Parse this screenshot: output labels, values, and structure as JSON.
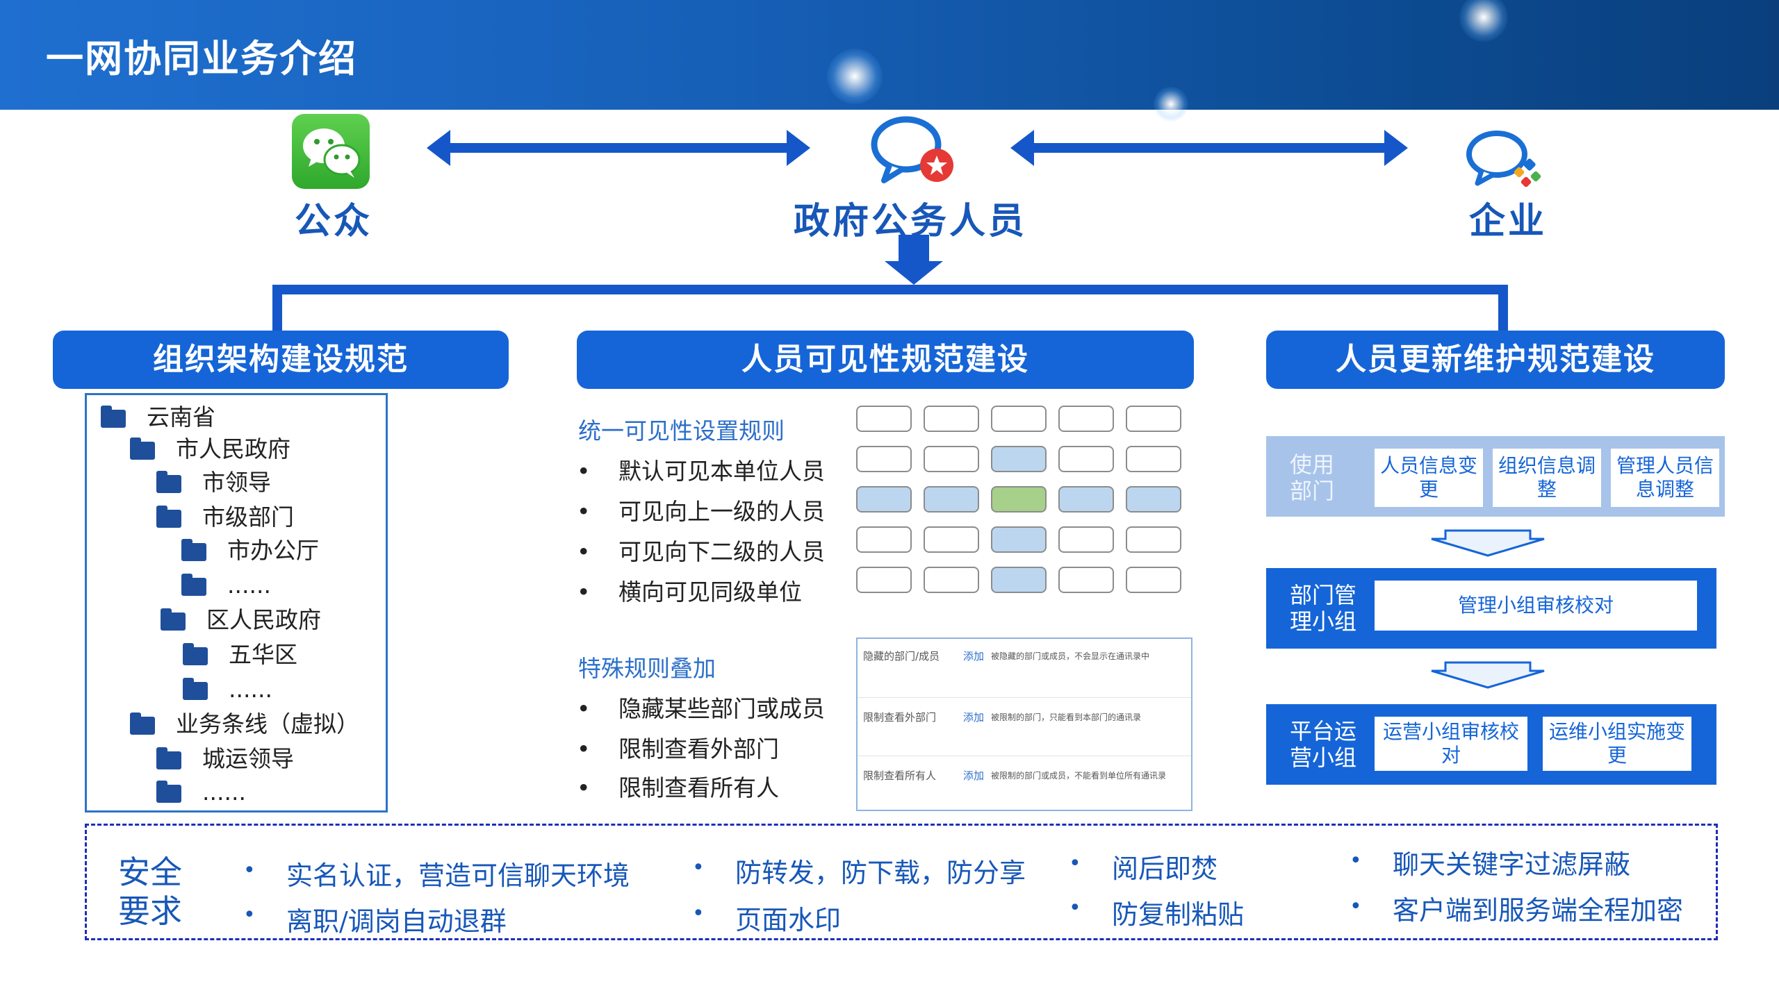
{
  "header": {
    "title": "一网协同业务介绍"
  },
  "actors": {
    "public": "公众",
    "gov": "政府公务人员",
    "enterprise": "企业"
  },
  "sections": {
    "org": "组织架构建设规范",
    "visibility": "人员可见性规范建设",
    "maintain": "人员更新维护规范建设"
  },
  "tree": [
    "云南省",
    "市人民政府",
    "市领导",
    "市级部门",
    "市办公厅",
    "......",
    "区人民政府",
    "五华区",
    "......",
    "业务条线（虚拟）",
    "城运领导",
    "......"
  ],
  "visibility": {
    "unified_title": "统一可见性设置规则",
    "unified_rules": [
      "默认可见本单位人员",
      "可见向上一级的人员",
      "可见向下二级的人员",
      "横向可见同级单位"
    ],
    "special_title": "特殊规则叠加",
    "special_rules": [
      "隐藏某些部门或成员",
      "限制查看外部门",
      "限制查看所有人"
    ],
    "special_box": [
      {
        "name": "隐藏的部门/成员",
        "action": "添加",
        "desc": "被隐藏的部门或成员，不会显示在通讯录中"
      },
      {
        "name": "限制查看外部门",
        "action": "添加",
        "desc": "被限制的部门，只能看到本部门的通讯录"
      },
      {
        "name": "限制查看所有人",
        "action": "添加",
        "desc": "被限制的部门或成员，不能看到单位所有通讯录"
      }
    ]
  },
  "maintain": {
    "use_dept": "使用部门",
    "use_boxes": [
      "人员信息变更",
      "组织信息调整",
      "管理人员信息调整"
    ],
    "mgmt_group": "部门管理小组",
    "mgmt_box": "管理小组审核校对",
    "ops_group": "平台运营小组",
    "ops_boxes": [
      "运营小组审核校对",
      "运维小组实施变更"
    ]
  },
  "security": {
    "label": "安全要求",
    "items": [
      "实名认证，营造可信聊天环境",
      "离职/调岗自动退群",
      "防转发，防下载，防分享",
      "页面水印",
      "阅后即焚",
      "防复制粘贴",
      "聊天关键字过滤屏蔽",
      "客户端到服务端全程加密"
    ]
  },
  "colors": {
    "primary": "#1565d8",
    "dark_blue": "#1757b8",
    "cell_blue": "#bcd6f0",
    "cell_green": "#a7d08a"
  }
}
